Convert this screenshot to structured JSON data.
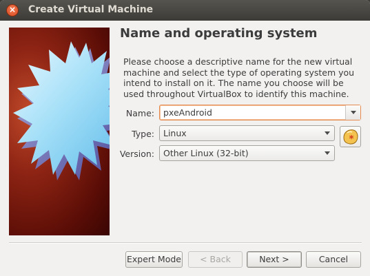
{
  "window": {
    "title": "Create Virtual Machine",
    "close_glyph": "×"
  },
  "page": {
    "heading": "Name and operating system",
    "description": "Please choose a descriptive name for the new virtual machine and select the type of operating system you intend to install on it. The name you choose will be used throughout VirtualBox to identify this machine."
  },
  "form": {
    "name": {
      "label": "Name:",
      "value": "pxeAndroid"
    },
    "type": {
      "label": "Type:",
      "value": "Linux"
    },
    "version": {
      "label": "Version:",
      "value": "Other Linux (32-bit)"
    },
    "os_icon": "linux-os-icon"
  },
  "buttons": {
    "expert_mode": "Expert Mode",
    "back": "< Back",
    "next": "Next >",
    "cancel": "Cancel"
  },
  "colors": {
    "accent": "#e58a4e",
    "banner_red": "#8e2414",
    "star_blue": "#8fd6f5"
  }
}
